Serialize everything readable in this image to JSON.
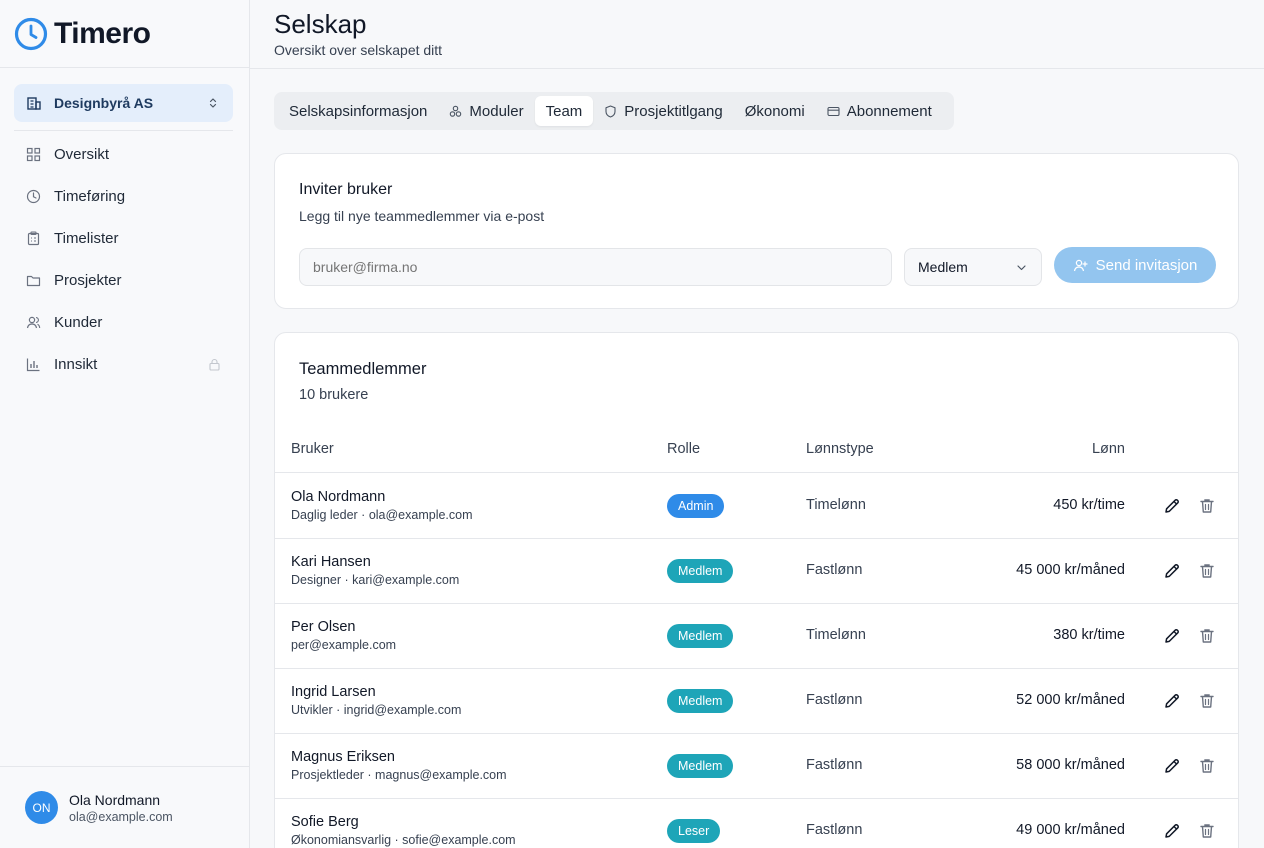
{
  "app": {
    "name": "Timero",
    "accent": "#2f8be8"
  },
  "sidebar": {
    "company": "Designbyrå AS",
    "items": [
      {
        "label": "Oversikt",
        "icon": "grid-icon"
      },
      {
        "label": "Timeføring",
        "icon": "clock-icon"
      },
      {
        "label": "Timelister",
        "icon": "clipboard-icon"
      },
      {
        "label": "Prosjekter",
        "icon": "folder-icon"
      },
      {
        "label": "Kunder",
        "icon": "users-icon"
      },
      {
        "label": "Innsikt",
        "icon": "bar-chart-icon",
        "locked": true
      }
    ],
    "user": {
      "initials": "ON",
      "name": "Ola Nordmann",
      "email": "ola@example.com"
    }
  },
  "header": {
    "title": "Selskap",
    "subtitle": "Oversikt over selskapet ditt"
  },
  "tabs": [
    {
      "label": "Selskapsinformasjon",
      "icon": ""
    },
    {
      "label": "Moduler",
      "icon": "modules-icon"
    },
    {
      "label": "Team",
      "icon": "",
      "active": true
    },
    {
      "label": "Prosjektitlgang",
      "icon": "shield-icon"
    },
    {
      "label": "Økonomi",
      "icon": ""
    },
    {
      "label": "Abonnement",
      "icon": "card-icon"
    }
  ],
  "invite": {
    "title": "Inviter bruker",
    "description": "Legg til nye teammedlemmer via e-post",
    "email_placeholder": "bruker@firma.no",
    "role_value": "Medlem",
    "send_label": "Send invitasjon"
  },
  "team": {
    "title": "Teammedlemmer",
    "count": "10 brukere",
    "columns": {
      "user": "Bruker",
      "role": "Rolle",
      "pay_type": "Lønnstype",
      "salary": "Lønn"
    },
    "rows": [
      {
        "name": "Ola Nordmann",
        "sub": "Daglig leder · ola@example.com",
        "role": "Admin",
        "role_color": "#2f8be8",
        "pay_type": "Timelønn",
        "salary": "450 kr/time"
      },
      {
        "name": "Kari Hansen",
        "sub": "Designer · kari@example.com",
        "role": "Medlem",
        "role_color": "#1ea5b8",
        "pay_type": "Fastlønn",
        "salary": "45 000 kr/måned"
      },
      {
        "name": "Per Olsen",
        "sub": "per@example.com",
        "role": "Medlem",
        "role_color": "#1ea5b8",
        "pay_type": "Timelønn",
        "salary": "380 kr/time"
      },
      {
        "name": "Ingrid Larsen",
        "sub": "Utvikler · ingrid@example.com",
        "role": "Medlem",
        "role_color": "#1ea5b8",
        "pay_type": "Fastlønn",
        "salary": "52 000 kr/måned"
      },
      {
        "name": "Magnus Eriksen",
        "sub": "Prosjektleder · magnus@example.com",
        "role": "Medlem",
        "role_color": "#1ea5b8",
        "pay_type": "Fastlønn",
        "salary": "58 000 kr/måned"
      },
      {
        "name": "Sofie Berg",
        "sub": "Økonomiansvarlig · sofie@example.com",
        "role": "Leser",
        "role_color": "#1ea5b8",
        "pay_type": "Fastlønn",
        "salary": "49 000 kr/måned"
      }
    ]
  }
}
